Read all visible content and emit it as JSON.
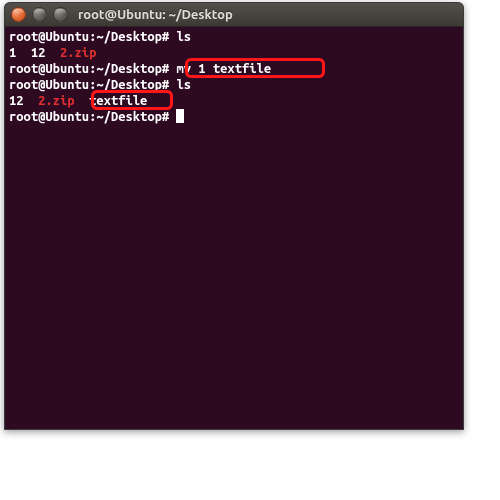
{
  "window": {
    "title": "root@Ubuntu: ~/Desktop"
  },
  "prompt": "root@Ubuntu:~/Desktop#",
  "lines": {
    "l0_cmd": "ls",
    "l1_f1": "1",
    "l1_f2": "12",
    "l1_f3": "2.zip",
    "l2_cmd": "mv 1 textfile",
    "l3_cmd": "ls",
    "l4_f1": "12",
    "l4_f2": "2.zip",
    "l4_f3": "textfile",
    "l5_cmd": ""
  },
  "highlights": {
    "cmd_box": "mv 1 textfile",
    "result_box": "textfile"
  }
}
